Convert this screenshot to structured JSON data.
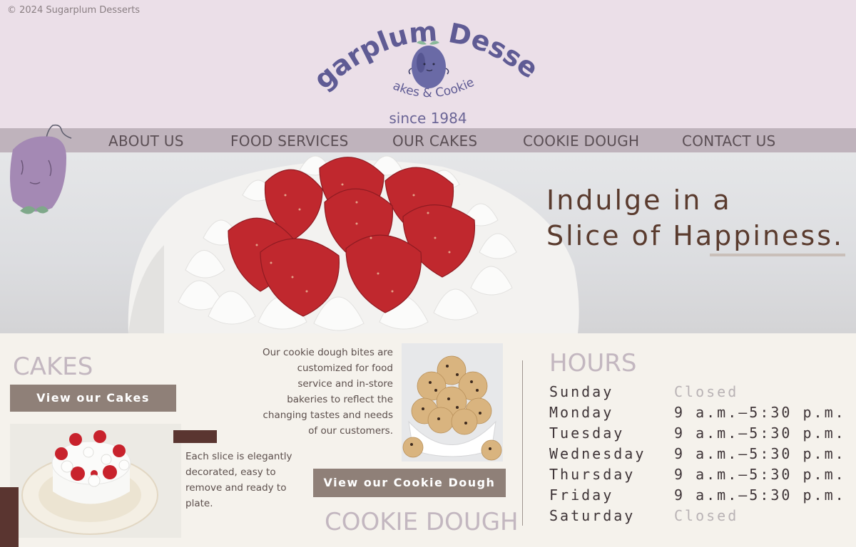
{
  "copyright": "© 2024 Sugarplum Desserts",
  "logo": {
    "name": "Sugarplum Desserts",
    "tagline": "Cakes & Cookies",
    "since": "since 1984"
  },
  "nav": {
    "items": [
      "ABOUT US",
      "FOOD SERVICES",
      "OUR CAKES",
      "COOKIE DOUGH",
      "CONTACT US"
    ]
  },
  "hero": {
    "line1": "Indulge in a",
    "line2": "Slice of Happiness."
  },
  "cakes": {
    "title": "CAKES",
    "button": "View our Cakes",
    "description": "Each slice is elegantly decorated, easy to remove and ready to plate."
  },
  "cookie_dough": {
    "title": "COOKIE DOUGH",
    "button": "View our Cookie Dough",
    "description": "Our cookie dough bites are customized for food service and in-store bakeries to reflect the changing tastes and needs of our customers."
  },
  "hours": {
    "title": "HOURS",
    "rows": [
      {
        "day": "Sunday",
        "time": "Closed"
      },
      {
        "day": "Monday",
        "time": "9 a.m.–5:30 p.m."
      },
      {
        "day": "Tuesday",
        "time": "9 a.m.–5:30 p.m."
      },
      {
        "day": "Wednesday",
        "time": "9 a.m.–5:30 p.m."
      },
      {
        "day": "Thursday",
        "time": "9 a.m.–5:30 p.m."
      },
      {
        "day": "Friday",
        "time": "9 a.m.–5:30 p.m."
      },
      {
        "day": "Saturday",
        "time": "Closed"
      }
    ]
  },
  "colors": {
    "header_bg": "#ebdfe8",
    "nav_bg": "#bfb3bc",
    "accent_brown": "#5a3530",
    "button_bg": "#8f8078",
    "logo_purple": "#5f5b94"
  }
}
